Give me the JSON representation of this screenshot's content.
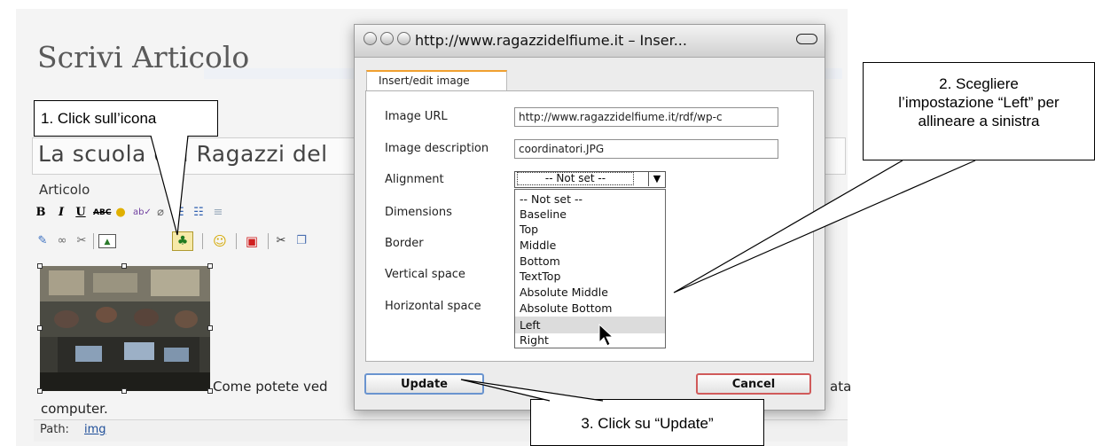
{
  "editor": {
    "page_title": "Scrivi Articolo",
    "post_title": "La scuola dei Ragazzi del",
    "article_label": "Articolo",
    "content_text": "Come potete ved",
    "content_tail": "ata",
    "content_line2": "computer.",
    "path_label": "Path:",
    "path_value": "img",
    "toolbar_row1": [
      "bold-icon",
      "italic-icon",
      "underline-icon",
      "strikethrough-icon",
      "smiley-small-icon",
      "spellcheck-icon",
      "eraser-icon",
      "ordered-list-icon",
      "unordered-list-icon",
      "outdent-icon"
    ],
    "toolbar_row2": [
      "edit-icon",
      "link-icon",
      "unlink-icon",
      "insert-image-icon",
      "insert-image-advanced-icon",
      "smiley-icon",
      "stop-icon",
      "cut-icon",
      "copy-icon"
    ]
  },
  "dialog": {
    "window_title": "http://www.ragazzidelfiume.it – Inser...",
    "tab_label": "Insert/edit image",
    "fields": {
      "image_url_label": "Image URL",
      "image_url_value": "http://www.ragazzidelfiume.it/rdf/wp-c",
      "image_desc_label": "Image description",
      "image_desc_value": "coordinatori.JPG",
      "alignment_label": "Alignment",
      "alignment_value": "-- Not set --",
      "dimensions_label": "Dimensions",
      "border_label": "Border",
      "vspace_label": "Vertical space",
      "hspace_label": "Horizontal space"
    },
    "alignment_options": [
      "-- Not set --",
      "Baseline",
      "Top",
      "Middle",
      "Bottom",
      "TextTop",
      "Absolute Middle",
      "Absolute Bottom",
      "Left",
      "Right"
    ],
    "highlighted_option": "Left",
    "update_label": "Update",
    "cancel_label": "Cancel"
  },
  "callouts": {
    "step1": "1. Click sull’icona",
    "step2_line1": "2. Scegliere",
    "step2_line2": "l’impostazione “Left” per",
    "step2_line3": "allineare a sinistra",
    "step3": "3. Click su “Update”"
  },
  "colors": {
    "tab_accent": "#f0a030",
    "update_border": "#6a94cf",
    "cancel_border": "#d05a5a"
  }
}
